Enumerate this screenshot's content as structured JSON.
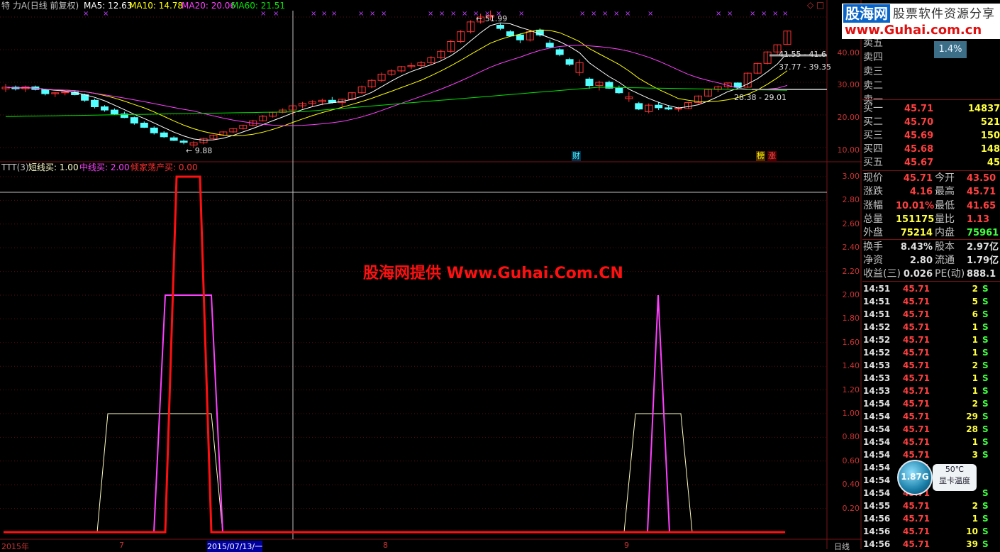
{
  "header": {
    "title": "特 力A(日线 前复权)",
    "ma5": "MA5: 12.63",
    "ma10": "MA10: 14.78",
    "ma20": "MA20: 20.06",
    "ma60": "MA60: 21.51"
  },
  "price_annotations": {
    "high": "51.99",
    "low": "9.88",
    "range1": "41.55 - 41.6",
    "range2": "37.77 - 39.35",
    "range3": "28.38 - 29.01",
    "cai": "财",
    "bang": "榜",
    "zhang": "涨"
  },
  "indicator_header": {
    "name": "TTT(3)",
    "short": "短线买: 1.00",
    "mid": "中线买: 2.00",
    "dump": "倾家荡产买: 0.00"
  },
  "watermark": "股海网提供 Www.Guhai.Com.CN",
  "logo": {
    "brand": "股海网",
    "slogan": "股票软件资源分享",
    "url": "www.Guhai.com.cn"
  },
  "price_axis": [
    "40.00",
    "30.00",
    "20.00",
    "10.00"
  ],
  "indicator_axis": [
    "3.00",
    "2.80",
    "2.60",
    "2.40",
    "2.20",
    "2.00",
    "1.80",
    "1.60",
    "1.40",
    "1.20",
    "1.00",
    "0.80",
    "0.60",
    "0.40",
    "0.20"
  ],
  "x_axis": [
    "2015年",
    "7",
    "2015/07/13/一",
    "8",
    "9",
    "日线"
  ],
  "badge_pct": "1.4%",
  "order_book": {
    "sell": [
      {
        "label": "卖五"
      },
      {
        "label": "卖四"
      },
      {
        "label": "卖三"
      },
      {
        "label": "卖二"
      },
      {
        "label": "卖一"
      }
    ],
    "buy": [
      {
        "label": "买一",
        "price": "45.71",
        "vol": "14837"
      },
      {
        "label": "买二",
        "price": "45.70",
        "vol": "521"
      },
      {
        "label": "买三",
        "price": "45.69",
        "vol": "150"
      },
      {
        "label": "买四",
        "price": "45.68",
        "vol": "148"
      },
      {
        "label": "买五",
        "price": "45.67",
        "vol": "45"
      }
    ]
  },
  "quote": [
    {
      "l1": "现价",
      "v1": "45.71",
      "l2": "今开",
      "v2": "43.50"
    },
    {
      "l1": "涨跌",
      "v1": "4.16",
      "l2": "最高",
      "v2": "45.71"
    },
    {
      "l1": "涨幅",
      "v1": "10.01%",
      "l2": "最低",
      "v2": "41.65"
    },
    {
      "l1": "总量",
      "v1": "151175",
      "l2": "量比",
      "v2": "1.13"
    },
    {
      "l1": "外盘",
      "v1": "75214",
      "l2": "内盘",
      "v2": "75961"
    },
    {
      "l1": "换手",
      "v1": "8.43%",
      "l2": "股本",
      "v2": "2.97亿"
    },
    {
      "l1": "净资",
      "v1": "2.80",
      "l2": "流通",
      "v2": "1.79亿"
    },
    {
      "l1": "收益(三)",
      "v1": "0.026",
      "l2": "PE(动)",
      "v2": "888.1"
    }
  ],
  "ticks": [
    {
      "t": "14:51",
      "p": "45.71",
      "v": "2",
      "s": "S"
    },
    {
      "t": "14:51",
      "p": "45.71",
      "v": "5",
      "s": "S"
    },
    {
      "t": "14:51",
      "p": "45.71",
      "v": "6",
      "s": "S"
    },
    {
      "t": "14:52",
      "p": "45.71",
      "v": "1",
      "s": "S"
    },
    {
      "t": "14:52",
      "p": "45.71",
      "v": "1",
      "s": "S"
    },
    {
      "t": "14:52",
      "p": "45.71",
      "v": "1",
      "s": "S"
    },
    {
      "t": "14:53",
      "p": "45.71",
      "v": "2",
      "s": "S"
    },
    {
      "t": "14:53",
      "p": "45.71",
      "v": "1",
      "s": "S"
    },
    {
      "t": "14:53",
      "p": "45.71",
      "v": "1",
      "s": "S"
    },
    {
      "t": "14:54",
      "p": "45.71",
      "v": "2",
      "s": "S"
    },
    {
      "t": "14:54",
      "p": "45.71",
      "v": "29",
      "s": "S"
    },
    {
      "t": "14:54",
      "p": "45.71",
      "v": "28",
      "s": "S"
    },
    {
      "t": "14:54",
      "p": "45.71",
      "v": "1",
      "s": "S"
    },
    {
      "t": "14:54",
      "p": "45.71",
      "v": "3",
      "s": "S"
    },
    {
      "t": "14:54",
      "p": "45.71",
      "v": "",
      "s": ""
    },
    {
      "t": "14:54",
      "p": "45.71",
      "v": "",
      "s": ""
    },
    {
      "t": "14:54",
      "p": "45.71",
      "v": "",
      "s": "S"
    },
    {
      "t": "14:55",
      "p": "45.71",
      "v": "2",
      "s": "S"
    },
    {
      "t": "14:56",
      "p": "45.71",
      "v": "1",
      "s": "S"
    },
    {
      "t": "14:56",
      "p": "45.71",
      "v": "10",
      "s": "S"
    },
    {
      "t": "14:56",
      "p": "45.71",
      "v": "39",
      "s": "S"
    }
  ],
  "gauge": {
    "value": "1.87G",
    "temp": "50℃",
    "label": "显卡温度"
  },
  "colors": {
    "up": "#ff3232",
    "down": "#54ffff",
    "ma5": "#ffffff",
    "ma10": "#ffff00",
    "ma20": "#ff40ff",
    "ma60": "#00e600",
    "grid": "#781414",
    "axis": "#c83232"
  },
  "chart_data": [
    {
      "type": "candlestick",
      "title": "特 力A(日线 前复权)",
      "ylabel": "",
      "ylim": [
        8,
        52
      ],
      "series": [
        {
          "name": "MA5",
          "values": [
            12.63
          ]
        },
        {
          "name": "MA10",
          "values": [
            14.78
          ]
        },
        {
          "name": "MA20",
          "values": [
            20.06
          ]
        },
        {
          "name": "MA60",
          "values": [
            21.51
          ]
        }
      ],
      "annotations": [
        "51.99",
        "9.88",
        "41.55 - 41.6",
        "37.77 - 39.35",
        "28.38 - 29.01"
      ]
    },
    {
      "type": "line",
      "title": "TTT(3)",
      "ylim": [
        0,
        3
      ],
      "series": [
        {
          "name": "短线买",
          "values": [
            0,
            0,
            1,
            1,
            1,
            1,
            1,
            0,
            0,
            0,
            0,
            1,
            1,
            1,
            0,
            0
          ]
        },
        {
          "name": "中线买",
          "values": [
            0,
            0,
            0,
            0,
            2,
            2,
            2,
            0,
            0,
            0,
            0,
            0,
            2,
            0,
            0,
            0
          ]
        },
        {
          "name": "倾家荡产买",
          "values": [
            0,
            0,
            0,
            0,
            0,
            3,
            3,
            0,
            0,
            0,
            0,
            0,
            0,
            0,
            0,
            0
          ]
        }
      ]
    }
  ]
}
